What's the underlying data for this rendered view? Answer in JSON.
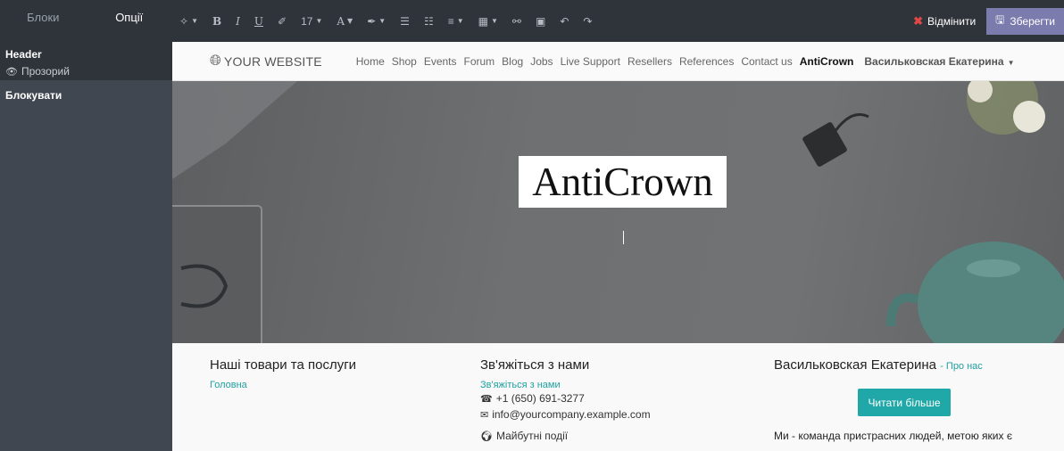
{
  "sidebar": {
    "tabs": [
      {
        "label": "Блоки",
        "active": false
      },
      {
        "label": "Опції",
        "active": true
      }
    ],
    "header_title": "Header",
    "transparent_label": "Прозорий",
    "lock_title": "Блокувати"
  },
  "toolbar": {
    "font_size": "17",
    "discard_label": "Відмінити",
    "save_label": "Зберегти"
  },
  "site_nav": {
    "logo_text": "YOUR WEBSITE",
    "items": [
      {
        "label": "Home",
        "active": false
      },
      {
        "label": "Shop",
        "active": false
      },
      {
        "label": "Events",
        "active": false
      },
      {
        "label": "Forum",
        "active": false
      },
      {
        "label": "Blog",
        "active": false
      },
      {
        "label": "Jobs",
        "active": false
      },
      {
        "label": "Live Support",
        "active": false
      },
      {
        "label": "Resellers",
        "active": false
      },
      {
        "label": "References",
        "active": false
      },
      {
        "label": "Contact us",
        "active": false
      },
      {
        "label": "AntiCrown",
        "active": true
      }
    ],
    "user_name": "Васильковская Екатерина"
  },
  "hero": {
    "title": "AntiCrown"
  },
  "footer": {
    "col1": {
      "title": "Наші товари та послуги",
      "link": "Головна"
    },
    "col2": {
      "title": "Зв'яжіться з нами",
      "link": "Зв'яжіться з нами",
      "phone": "+1 (650) 691-3277",
      "email": "info@yourcompany.example.com",
      "events": "Майбутні події"
    },
    "col3": {
      "title": "Васильковская Екатерина",
      "about_link": "Про нас",
      "read_more": "Читати більше",
      "text": "Ми - команда пристрасних людей, метою яких є"
    }
  },
  "colors": {
    "sidebar_bg": "#2f343b",
    "save_button": "#7c7bad",
    "discard_icon": "#e04848",
    "accent_teal": "#20a8a8"
  }
}
